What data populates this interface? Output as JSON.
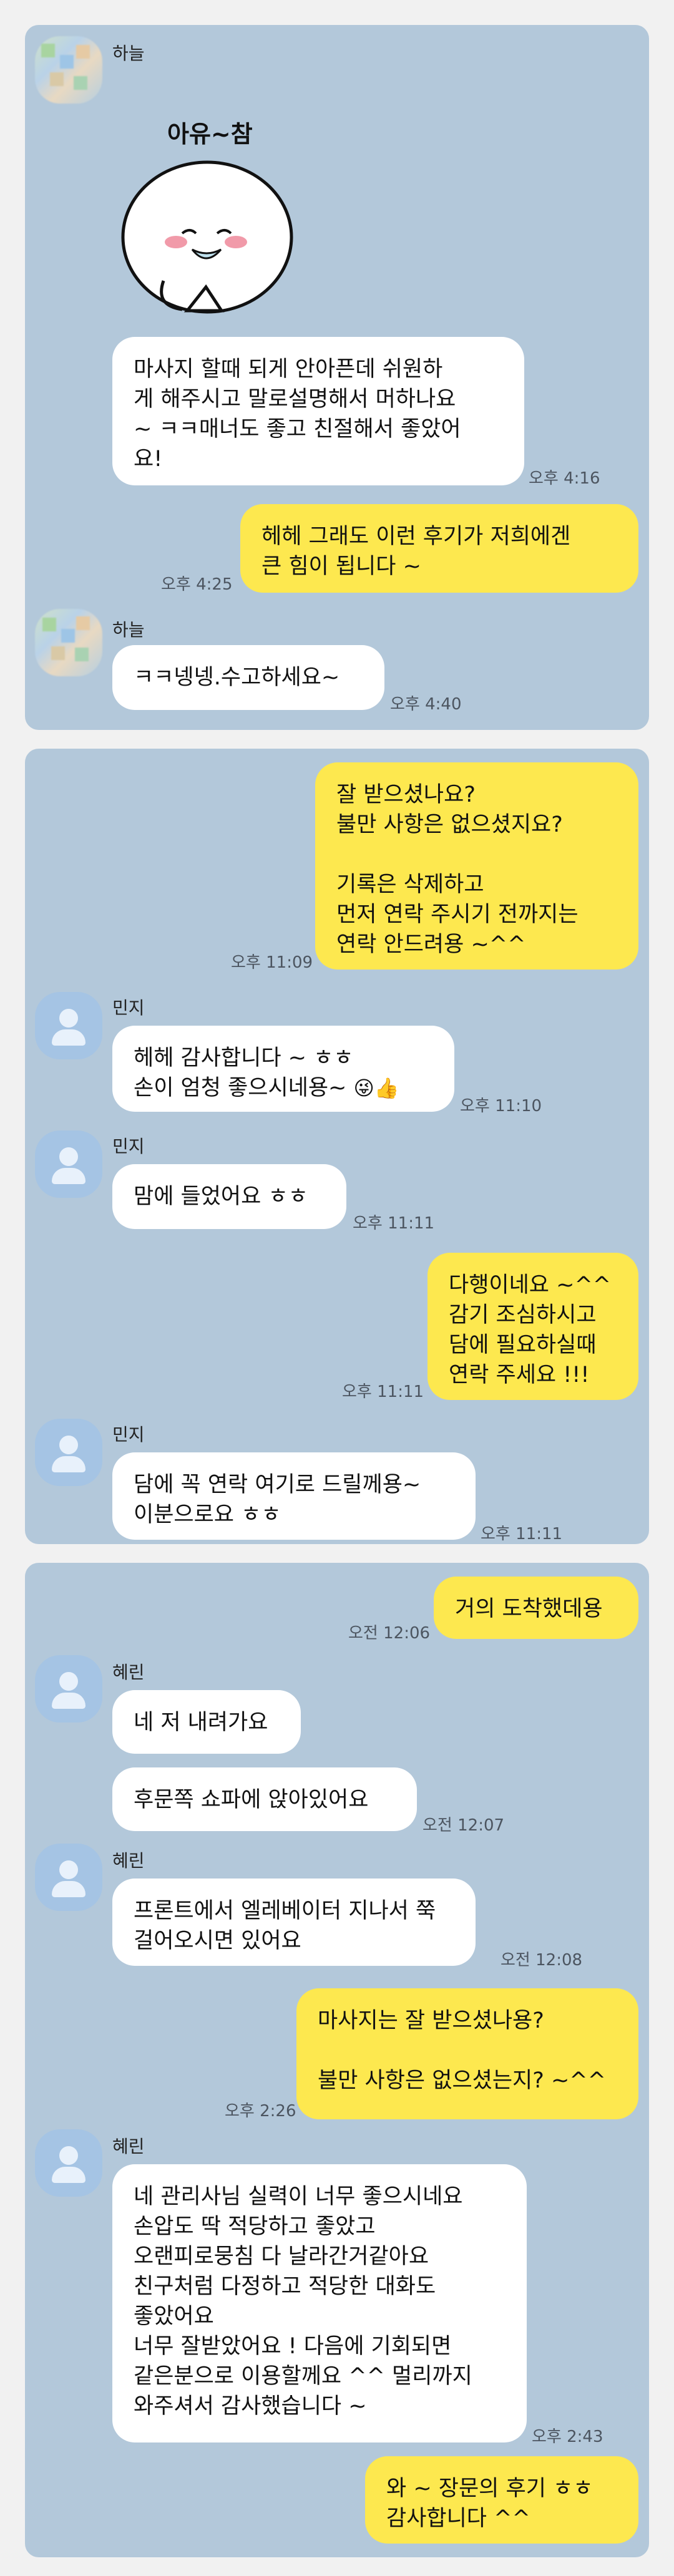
{
  "panel1": {
    "sender": "하늘",
    "sticker_text": "아유~참",
    "msg1": {
      "text": "마사지 할때 되게 안아픈데 쉬원하\n게 해주시고 말로설명해서 머하나요\n~ ㅋㅋ매너도 좋고 친절해서 좋았어\n요!",
      "time": "오후 4:16"
    },
    "reply1": {
      "text": "헤헤 그래도 이런 후기가 저희에겐\n큰 힘이 됩니다 ~",
      "time": "오후 4:25"
    },
    "sender2": "하늘",
    "msg2": {
      "text": "ㅋㅋ넹넹.수고하세요~",
      "time": "오후 4:40"
    }
  },
  "panel2": {
    "mine1": {
      "text": "잘 받으셨나요?\n불만 사항은 없으셨지요?\n\n기록은 삭제하고\n먼저 연락 주시기 전까지는\n연락 안드려용 ~^^",
      "time": "오후 11:09"
    },
    "sender1": "민지",
    "msg1": {
      "text": "헤헤 감사합니다 ~ ㅎㅎ\n손이 엄청 좋으시네용~",
      "emoji": "😜👍",
      "time": "오후 11:10"
    },
    "sender2": "민지",
    "msg2": {
      "text": "맘에 들었어요 ㅎㅎ",
      "time": "오후 11:11"
    },
    "mine2": {
      "text": "다행이네요 ~^^\n감기 조심하시고\n담에 필요하실때\n연락 주세요 !!!",
      "time": "오후 11:11"
    },
    "sender3": "민지",
    "msg3": {
      "text": "담에 꼭 연락 여기로 드릴께용~\n이분으로요 ㅎㅎ",
      "time": "오후 11:11"
    }
  },
  "panel3": {
    "mine1": {
      "text": "거의 도착했데용",
      "time": "오전 12:06"
    },
    "sender1": "혜린",
    "msg1": {
      "text": "네 저 내려가요"
    },
    "msg2": {
      "text": "후문쪽 쇼파에 앉아있어요",
      "time": "오전 12:07"
    },
    "sender2": "혜린",
    "msg3": {
      "text": "프론트에서 엘레베이터 지나서 쭉\n걸어오시면 있어요",
      "time": "오전 12:08"
    },
    "mine2": {
      "text": "마사지는 잘 받으셨나용?\n\n불만 사항은 없으셨는지? ~^^",
      "time": "오후 2:26"
    },
    "sender3": "혜린",
    "msg4": {
      "text": "네 관리사님 실력이 너무 좋으시네요\n손압도 딱 적당하고 좋았고\n오랜피로뭉침 다 날라간거같아요\n친구처럼 다정하고 적당한 대화도\n좋았어요\n너무 잘받았어요 ! 다음에 기회되면\n같은분으로 이용할께요 ^^ 멀리까지\n와주셔서 감사했습니다 ~",
      "time": "오후 2:43"
    },
    "mine3": {
      "text": "와 ~ 장문의 후기 ㅎㅎ\n감사합니다 ^^"
    }
  }
}
